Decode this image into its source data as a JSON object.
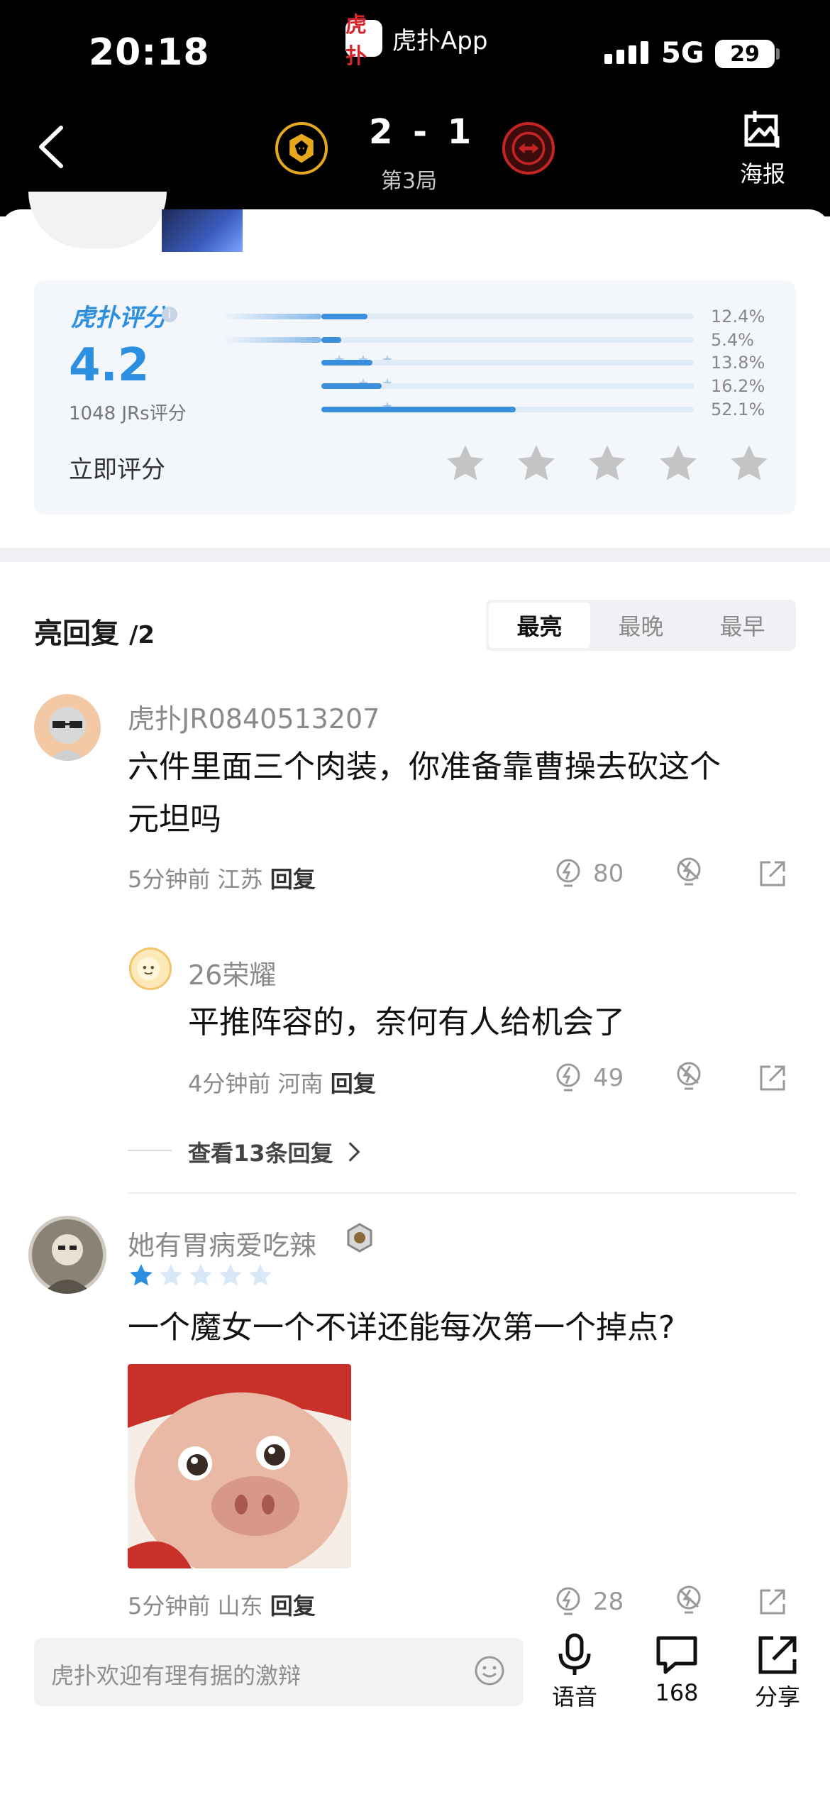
{
  "status_bar": {
    "time": "20:18",
    "app_logo_text": "虎扑",
    "app_name": "虎扑App",
    "network": "5G",
    "battery": "29"
  },
  "match": {
    "score": "2 - 1",
    "game_label": "第3局",
    "home_team_icon": "wolf-team-logo",
    "away_team_icon": "jdg-team-logo",
    "poster_label": "海报"
  },
  "rating": {
    "brand_label": "虎扑评分",
    "score": "4.2",
    "jrs_count": "1048 JRs评分",
    "bars": [
      {
        "stars": "",
        "percent_label": "12.4%",
        "value": 12.4
      },
      {
        "stars": "",
        "percent_label": "5.4%",
        "value": 5.4
      },
      {
        "stars": "★ ★ ★",
        "percent_label": "13.8%",
        "value": 13.8
      },
      {
        "stars": "★ ★",
        "percent_label": "16.2%",
        "value": 16.2
      },
      {
        "stars": "★",
        "percent_label": "52.1%",
        "value": 52.1
      }
    ],
    "rate_now_label": "立即评分"
  },
  "replies": {
    "title": "亮回复",
    "count": "/2",
    "tabs": [
      {
        "label": "最亮",
        "active": true
      },
      {
        "label": "最晚",
        "active": false
      },
      {
        "label": "最早",
        "active": false
      }
    ],
    "comments": [
      {
        "username": "虎扑JR0840513207",
        "text_line1": "六件里面三个肉装，你准备靠曹操去砍这个",
        "text_line2": "元坦吗",
        "time": "5分钟前",
        "location": "江苏",
        "reply_label": "回复",
        "likes": "80"
      },
      {
        "username": "26荣耀",
        "text": "平推阵容的，奈何有人给机会了",
        "time": "4分钟前",
        "location": "河南",
        "reply_label": "回复",
        "likes": "49"
      },
      {
        "username": "她有胃病爱吃辣",
        "rating_stars": 1,
        "text": "一个魔女一个不详还能每次第一个掉点?",
        "time": "5分钟前",
        "location": "山东",
        "reply_label": "回复",
        "likes": "28"
      }
    ],
    "view_more": "查看13条回复"
  },
  "bottom_bar": {
    "input_placeholder": "虎扑欢迎有理有据的激辩",
    "voice_label": "语音",
    "comment_count": "168",
    "share_label": "分享"
  },
  "colors": {
    "accent": "#2d8fe0",
    "header_bg": "#000000",
    "star_gray": "#c4c4c4"
  }
}
